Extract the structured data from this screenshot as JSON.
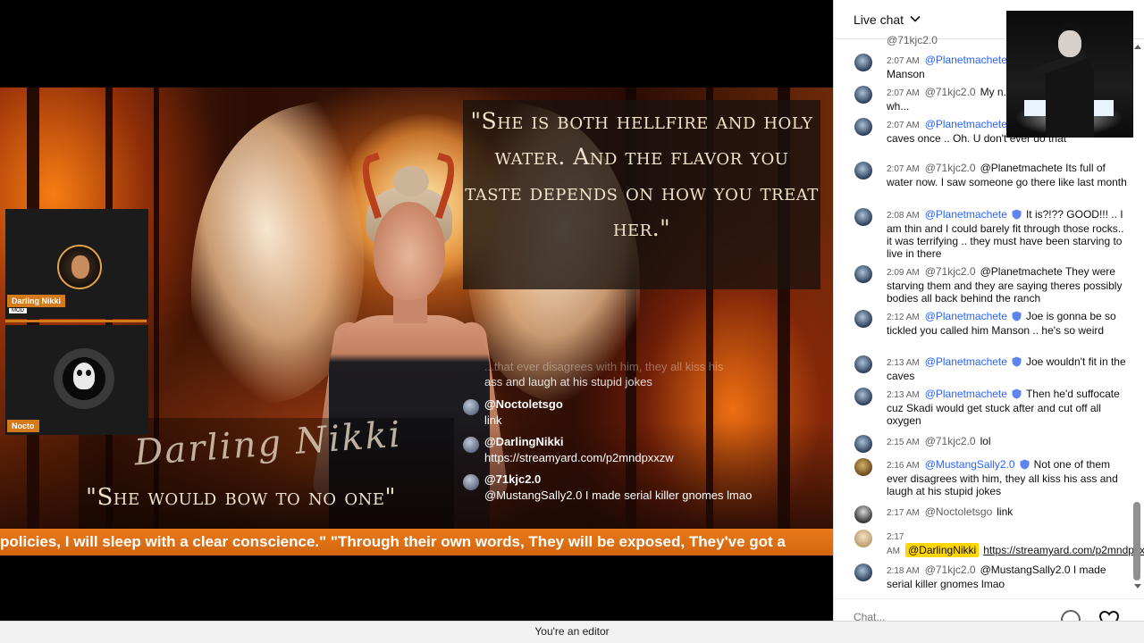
{
  "stream": {
    "quote": "\"She is both hellfire and holy water. And the flavor you taste depends on how you treat her.\"",
    "script_name": "Darling Nikki",
    "bow_quote": "\"She would bow to no one\"",
    "ghost_message": {
      "text": "...that ever disagrees with him, they all kiss his",
      "continued": "ass and laugh at his stupid jokes"
    },
    "overlay_messages": [
      {
        "author": "@Noctoletsgo",
        "text": "link"
      },
      {
        "author": "@DarlingNikki",
        "text": "https://streamyard.com/p2mndpxxzw"
      },
      {
        "author": "@71kjc2.0",
        "text": "@MustangSally2.0 I made serial killer gnomes lmao"
      }
    ],
    "guests": [
      {
        "name": "Darling Nikki",
        "sub": "MOD"
      },
      {
        "name": "Nocto"
      }
    ],
    "ticker": "policies, I will sleep with a clear conscience.\" \"Through their own words, They will be exposed, They've got a"
  },
  "chat": {
    "title": "Live chat",
    "partial_top": "@71kjc2.0",
    "messages": [
      {
        "time": "2:07 AM",
        "author": "@Planetmachete",
        "author_style": "mod",
        "badge": true,
        "text": "Manson women, Manson",
        "avatar": "default"
      },
      {
        "time": "2:07 AM",
        "author": "@71kjc2.0",
        "author_style": "normal",
        "badge": false,
        "text": "My n... canal again like it was wh...",
        "avatar": "default"
      },
      {
        "time": "2:07 AM",
        "author": "@Planetmachete",
        "author_style": "mod",
        "badge": true,
        "text": "went to the Manson caves once .. Oh. U don't ever do that",
        "avatar": "default"
      },
      {
        "time": "2:07 AM",
        "author": "@71kjc2.0",
        "author_style": "normal",
        "badge": false,
        "text": "@Planetmachete Its full of water now. I saw someone go there like last month",
        "avatar": "default"
      },
      {
        "time": "2:08 AM",
        "author": "@Planetmachete",
        "author_style": "mod",
        "badge": true,
        "text": "It is?!?? GOOD!!! .. I am thin and I could barely fit through those rocks.. it was terrifying .. they must have been starving to live in there",
        "avatar": "default"
      },
      {
        "time": "2:09 AM",
        "author": "@71kjc2.0",
        "author_style": "normal",
        "badge": false,
        "text": "@Planetmachete They were starving them and they are saying theres possibly bodies all back behind the ranch",
        "avatar": "default"
      },
      {
        "time": "2:12 AM",
        "author": "@Planetmachete",
        "author_style": "mod",
        "badge": true,
        "text": "Joe is gonna be so tickled you called him Manson .. he's so weird",
        "avatar": "default"
      },
      {
        "time": "2:13 AM",
        "author": "@Planetmachete",
        "author_style": "mod",
        "badge": true,
        "text": "Joe wouldn't fit in the caves",
        "avatar": "default"
      },
      {
        "time": "2:13 AM",
        "author": "@Planetmachete",
        "author_style": "mod",
        "badge": true,
        "text": "Then he'd suffocate cuz Skadi would get stuck after and cut off all oxygen",
        "avatar": "default"
      },
      {
        "time": "2:15 AM",
        "author": "@71kjc2.0",
        "author_style": "normal",
        "badge": false,
        "text": "lol",
        "avatar": "default"
      },
      {
        "time": "2:16 AM",
        "author": "@MustangSally2.0",
        "author_style": "mod",
        "badge": true,
        "text": "Not one of them ever disagrees with him, they all kiss his ass and laugh at his stupid jokes",
        "avatar": "gold"
      },
      {
        "time": "2:17 AM",
        "author": "@Noctoletsgo",
        "author_style": "normal",
        "badge": false,
        "text": "link",
        "avatar": "person"
      },
      {
        "time": "2:17 AM",
        "author": "@DarlingNikki",
        "author_style": "highlight",
        "badge": false,
        "text": "https://streamyard.com/p2mndpxxzw",
        "is_link": true,
        "avatar": "blonde"
      },
      {
        "time": "2:18 AM",
        "author": "@71kjc2.0",
        "author_style": "normal",
        "badge": false,
        "text": "@MustangSally2.0 I made serial killer gnomes lmao",
        "avatar": "default"
      }
    ],
    "input_placeholder": "Chat..."
  },
  "status_bar": {
    "text": "You're an editor"
  },
  "colors": {
    "ticker_bg": "#e06e14",
    "mod_author": "#2962ff",
    "owner_highlight": "#ffd600",
    "guest_tag": "#d47a1a"
  },
  "icons": {
    "chevron": "chevron-down-icon",
    "badge": "verified-badge-icon",
    "emoji": "emoji-icon",
    "heart": "heart-icon"
  }
}
